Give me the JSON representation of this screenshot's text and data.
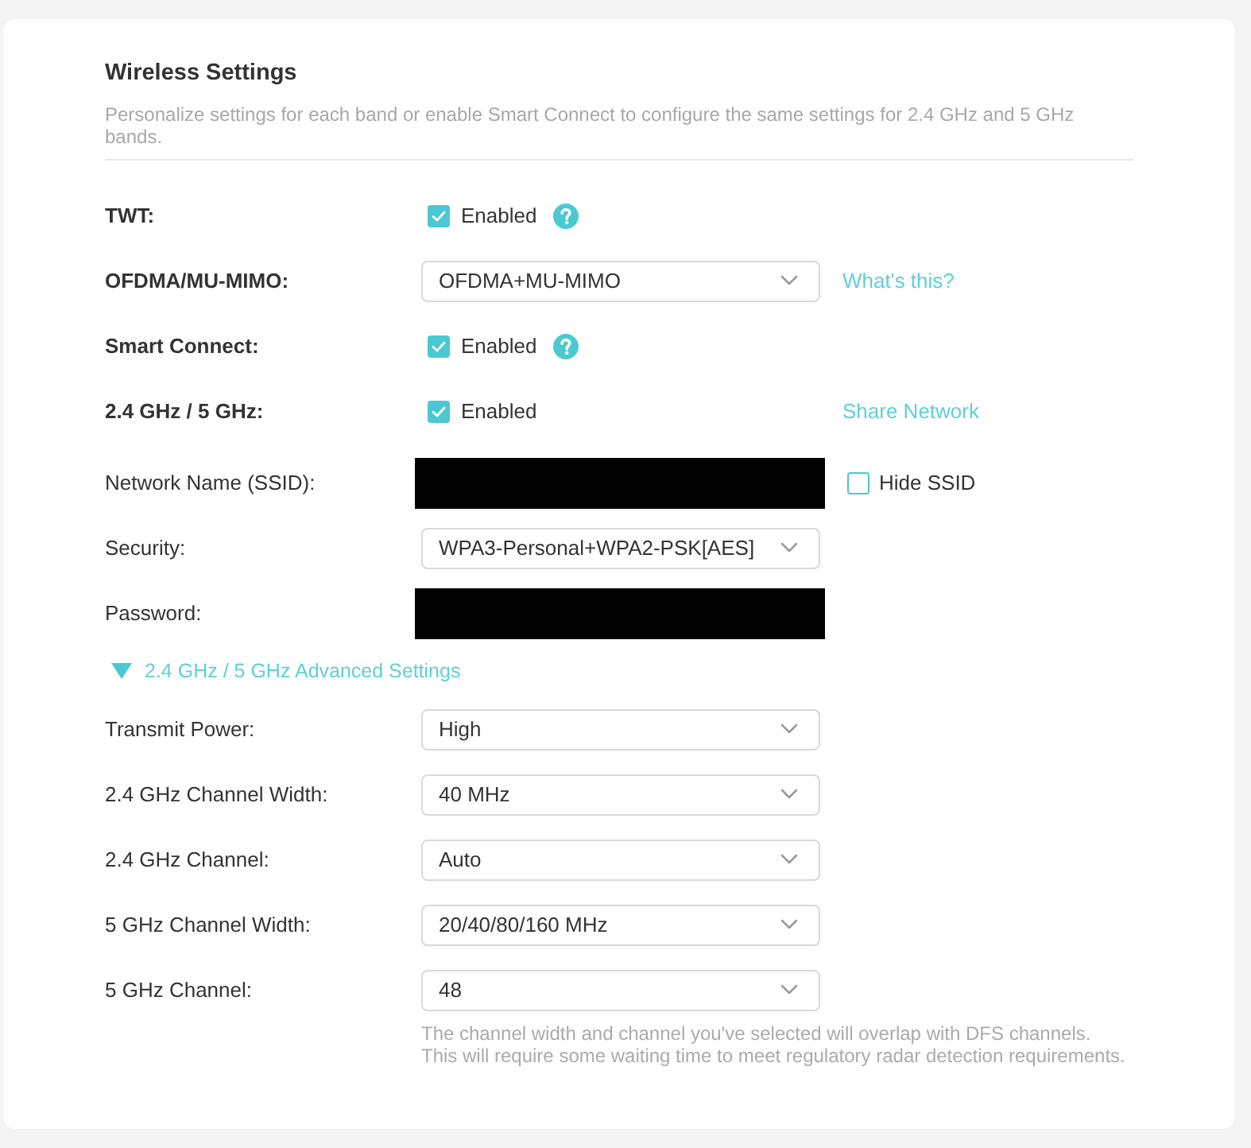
{
  "header": {
    "title": "Wireless Settings",
    "description": "Personalize settings for each band or enable Smart Connect to configure the same settings for 2.4 GHz and 5 GHz bands."
  },
  "feature_rows": [
    {
      "label": "TWT:",
      "kind": "checkbox",
      "checked": true,
      "option": "Enabled",
      "help": true
    },
    {
      "label": "OFDMA/MU-MIMO:",
      "kind": "select",
      "value": "OFDMA+MU-MIMO",
      "link": "What's this?"
    },
    {
      "label": "Smart Connect:",
      "kind": "checkbox",
      "checked": true,
      "option": "Enabled",
      "help": true
    },
    {
      "label": "2.4 GHz / 5 GHz:",
      "kind": "checkbox",
      "checked": true,
      "option": "Enabled",
      "link": "Share Network"
    }
  ],
  "band_rows": [
    {
      "label": "Network Name (SSID):",
      "kind": "redacted",
      "side_checkbox": {
        "label": "Hide SSID",
        "checked": false
      }
    },
    {
      "label": "Security:",
      "kind": "select",
      "value": "WPA3-Personal+WPA2-PSK[AES]"
    },
    {
      "label": "Password:",
      "kind": "redacted"
    }
  ],
  "advanced": {
    "title": "2.4 GHz / 5 GHz Advanced Settings",
    "expanded": true,
    "rows": [
      {
        "label": "Transmit Power:",
        "kind": "select",
        "value": "High"
      },
      {
        "label": "2.4 GHz Channel Width:",
        "kind": "select",
        "value": "40 MHz"
      },
      {
        "label": "2.4 GHz Channel:",
        "kind": "select",
        "value": "Auto"
      },
      {
        "label": "5 GHz Channel Width:",
        "kind": "select",
        "value": "20/40/80/160 MHz"
      },
      {
        "label": "5 GHz Channel:",
        "kind": "select",
        "value": "48",
        "note": "The channel width and channel you've selected will overlap with DFS channels. This will require some waiting time to meet regulatory radar detection requirements."
      }
    ]
  }
}
